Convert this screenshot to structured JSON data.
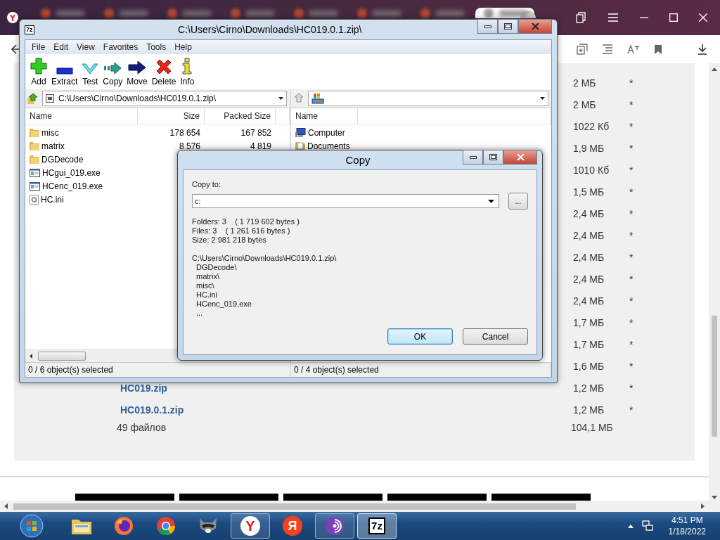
{
  "browser": {
    "tabs": [
      {
        "selected": false
      },
      {
        "selected": false
      },
      {
        "selected": false
      },
      {
        "selected": false
      },
      {
        "selected": false
      },
      {
        "selected": false
      },
      {
        "selected": false
      },
      {
        "selected": true
      }
    ]
  },
  "file_list": {
    "rows": [
      {
        "size": "2 МБ",
        "mark": "*"
      },
      {
        "size": "2 МБ",
        "mark": "*"
      },
      {
        "size": "1022 Кб",
        "mark": "*"
      },
      {
        "size": "1,9 МБ",
        "mark": "*"
      },
      {
        "size": "1010 Кб",
        "mark": "*"
      },
      {
        "size": "1,5 МБ",
        "mark": "*"
      },
      {
        "size": "2,4 МБ",
        "mark": "*"
      },
      {
        "size": "2,4 МБ",
        "mark": "*"
      },
      {
        "size": "2,4 МБ",
        "mark": "*"
      },
      {
        "size": "2,4 МБ",
        "mark": "*"
      },
      {
        "size": "2,4 МБ",
        "mark": "*"
      },
      {
        "size": "1,7 МБ",
        "mark": "*"
      },
      {
        "size": "1,7 МБ",
        "mark": "*"
      },
      {
        "size": "1,6 МБ",
        "mark": "*"
      },
      {
        "name": "HC019.zip",
        "size": "1,2 МБ",
        "mark": "*"
      },
      {
        "name": "HC019.0.1.zip",
        "size": "1,2 МБ",
        "mark": "*"
      }
    ],
    "total": {
      "count": "49 файлов",
      "size": "104,1 МБ"
    }
  },
  "archiver": {
    "app_icon": "7z",
    "title": "C:\\Users\\Cirno\\Downloads\\HC019.0.1.zip\\",
    "menu": [
      "File",
      "Edit",
      "View",
      "Favorites",
      "Tools",
      "Help"
    ],
    "toolbar": [
      {
        "label": "Add",
        "kind": "add"
      },
      {
        "label": "Extract",
        "kind": "extract"
      },
      {
        "label": "Test",
        "kind": "test"
      },
      {
        "label": "Copy",
        "kind": "copy"
      },
      {
        "label": "Move",
        "kind": "move"
      },
      {
        "label": "Delete",
        "kind": "delete"
      },
      {
        "label": "Info",
        "kind": "info"
      }
    ],
    "left_pane": {
      "path": "C:\\Users\\Cirno\\Downloads\\HC019.0.1.zip\\",
      "columns": [
        "Name",
        "Size",
        "Packed Size"
      ],
      "rows": [
        {
          "name": "misc",
          "kind": "folder",
          "size": "178 654",
          "packed": "167 852"
        },
        {
          "name": "matrix",
          "kind": "folder",
          "size": "8 576",
          "packed": "4 819"
        },
        {
          "name": "DGDecode",
          "kind": "folder"
        },
        {
          "name": "HCgui_019.exe",
          "kind": "exe"
        },
        {
          "name": "HCenc_019.exe",
          "kind": "exe"
        },
        {
          "name": "HC.ini",
          "kind": "ini"
        }
      ]
    },
    "right_pane": {
      "columns": [
        "Name"
      ],
      "rows": [
        {
          "name": "Computer",
          "kind": "computer"
        },
        {
          "name": "Documents",
          "kind": "documents"
        }
      ]
    },
    "status": [
      "0 / 6 object(s) selected",
      "0 / 4 object(s) selected"
    ]
  },
  "dialog": {
    "title": "Copy",
    "label": "Copy to:",
    "value": "c:",
    "browse": "...",
    "info": [
      "Folders: 3    ( 1 719 602 bytes )",
      "Files: 3    ( 1 261 616 bytes )",
      "Size: 2 981 218 bytes"
    ],
    "path": "C:\\Users\\Cirno\\Downloads\\HC019.0.1.zip\\",
    "items": [
      "DGDecode\\",
      "matrix\\",
      "misc\\",
      "HC.ini",
      "HCenc_019.exe",
      "..."
    ],
    "buttons": [
      {
        "label": "OK",
        "default": true
      },
      {
        "label": "Cancel",
        "default": false
      }
    ]
  },
  "taskbar": {
    "apps": [
      {
        "kind": "explorer",
        "running": false,
        "selected": false
      },
      {
        "kind": "firefox",
        "running": false,
        "selected": false
      },
      {
        "kind": "chrome",
        "running": false,
        "selected": false
      },
      {
        "kind": "raccoon",
        "running": false,
        "selected": false
      },
      {
        "kind": "yandex",
        "glyph": "Y",
        "running": true,
        "selected": false
      },
      {
        "kind": "yandex-red",
        "glyph": "Я",
        "running": false,
        "selected": false
      },
      {
        "kind": "tor",
        "running": true,
        "selected": false
      },
      {
        "kind": "sevenzip",
        "glyph": "7z",
        "running": true,
        "selected": true
      }
    ],
    "time": "4:51 PM",
    "date": "1/18/2022"
  }
}
